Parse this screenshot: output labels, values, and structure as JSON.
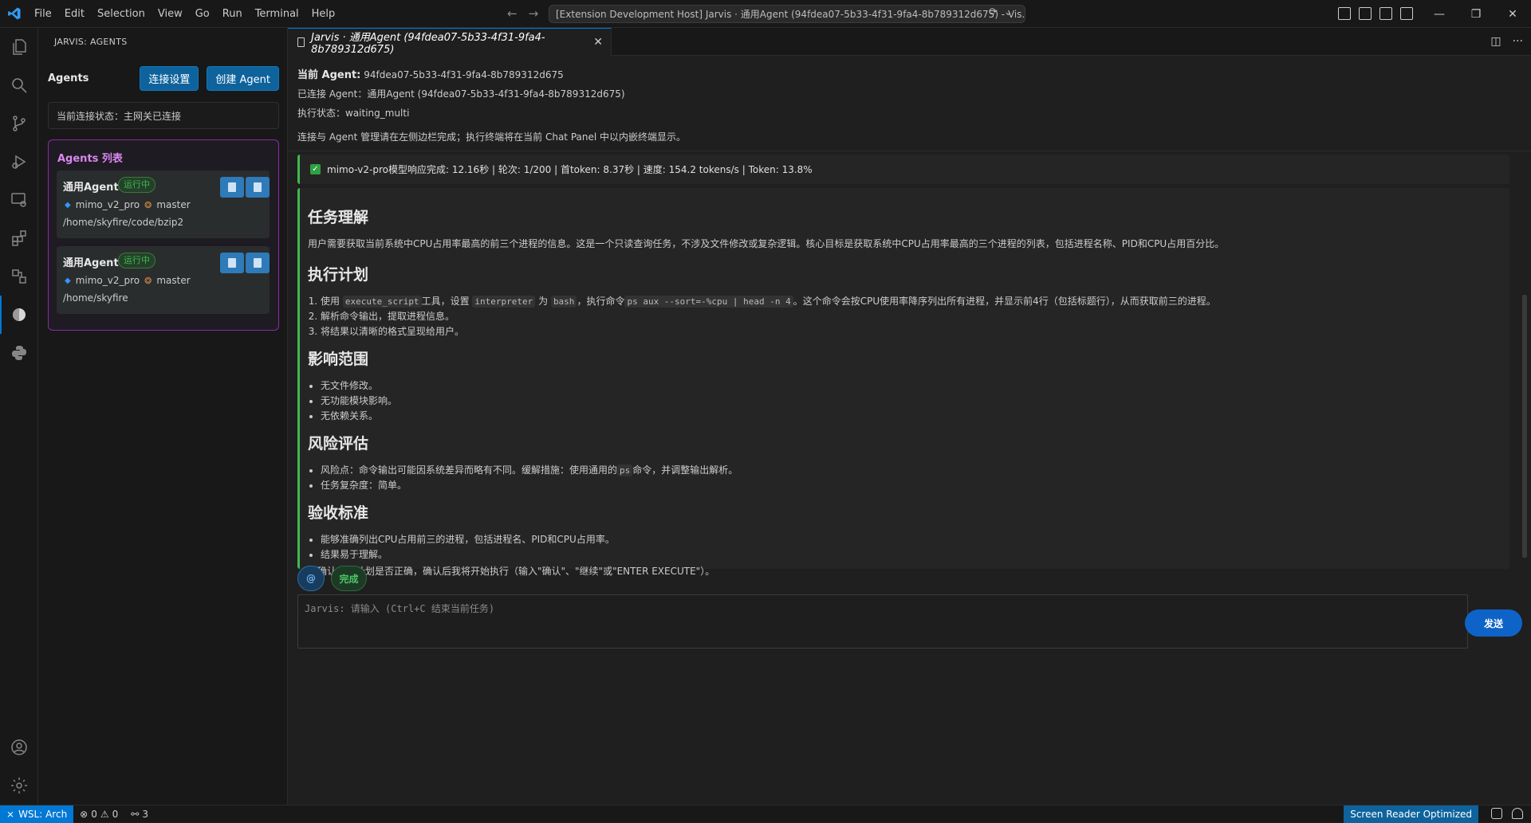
{
  "titlebar": {
    "menu": [
      "File",
      "Edit",
      "Selection",
      "View",
      "Go",
      "Run",
      "Terminal",
      "Help"
    ],
    "command_center": "[Extension Development Host] Jarvis · 通用Agent (94fdea07-5b33-4f31-9fa4-8b789312d675) - Vis..."
  },
  "sidebar": {
    "title": "JARVIS: AGENTS",
    "header": "Agents",
    "connect_settings": "连接设置",
    "create_agent": "创建 Agent",
    "connection_status": "当前连接状态：主网关已连接",
    "panel_title": "Agents 列表",
    "agents": [
      {
        "name": "通用Agent",
        "status": "运行中",
        "model": "mimo_v2_pro",
        "branch": "master",
        "path": "/home/skyfire/code/bzip2"
      },
      {
        "name": "通用Agent",
        "status": "运行中",
        "model": "mimo_v2_pro",
        "branch": "master",
        "path": "/home/skyfire"
      }
    ]
  },
  "editor": {
    "tab_label": "Jarvis · 通用Agent (94fdea07-5b33-4f31-9fa4-8b789312d675)",
    "current_agent_label": "当前 Agent:",
    "current_agent_id": "94fdea07-5b33-4f31-9fa4-8b789312d675",
    "connected_agent": "已连接 Agent：通用Agent (94fdea07-5b33-4f31-9fa4-8b789312d675)",
    "exec_status": "执行状态：waiting_multi",
    "hint": "连接与 Agent 管理请在左侧边栏完成；执行终端将在当前 Chat Panel 中以内嵌终端显示。",
    "response": "mimo-v2-pro模型响应完成: 12.16秒 | 轮次: 1/200 | 首token: 8.37秒 | 速度: 154.2 tokens/s | Token: 13.8%",
    "message": {
      "h1": "任务理解",
      "p1": "用户需要获取当前系统中CPU占用率最高的前三个进程的信息。这是一个只读查询任务，不涉及文件修改或复杂逻辑。核心目标是获取系统中CPU占用率最高的三个进程的列表，包括进程名称、PID和CPU占用百分比。",
      "h2": "执行计划",
      "step1_a": "使用",
      "step1_code1": "execute_script",
      "step1_b": "工具，设置",
      "step1_code2": "interpreter",
      "step1_c": "为",
      "step1_code3": "bash",
      "step1_d": "，执行命令",
      "step1_code4": "ps aux --sort=-%cpu | head -n 4",
      "step1_e": "。这个命令会按CPU使用率降序列出所有进程，并显示前4行（包括标题行），从而获取前三的进程。",
      "step2": "解析命令输出，提取进程信息。",
      "step3": "将结果以清晰的格式呈现给用户。",
      "h3": "影响范围",
      "scope": [
        "无文件修改。",
        "无功能模块影响。",
        "无依赖关系。"
      ],
      "h4": "风险评估",
      "risk_a": "风险点：命令输出可能因系统差异而略有不同。缓解措施：使用通用的",
      "risk_code": "ps",
      "risk_b": "命令，并调整输出解析。",
      "risk2": "任务复杂度：简单。",
      "h5": "验收标准",
      "accept": [
        "能够准确列出CPU占用前三的进程，包括进程名、PID和CPU占用率。",
        "结果易于理解。"
      ],
      "confirm": "请确认以上计划是否正确，确认后我将开始执行（输入\"确认\"、\"继续\"或\"ENTER EXECUTE\"）。"
    },
    "chip_at": "@",
    "chip_done": "完成",
    "input_placeholder": "Jarvis: 请输入 (Ctrl+C 结束当前任务)",
    "send": "发送"
  },
  "statusbar": {
    "remote": "WSL: Arch",
    "errors": "0",
    "warnings": "0",
    "ports": "3",
    "screen_reader": "Screen Reader Optimized"
  },
  "colors": {
    "accent": "#0078d4",
    "success": "#3fb950",
    "purple": "#8e2aa8",
    "button": "#0e639c"
  }
}
